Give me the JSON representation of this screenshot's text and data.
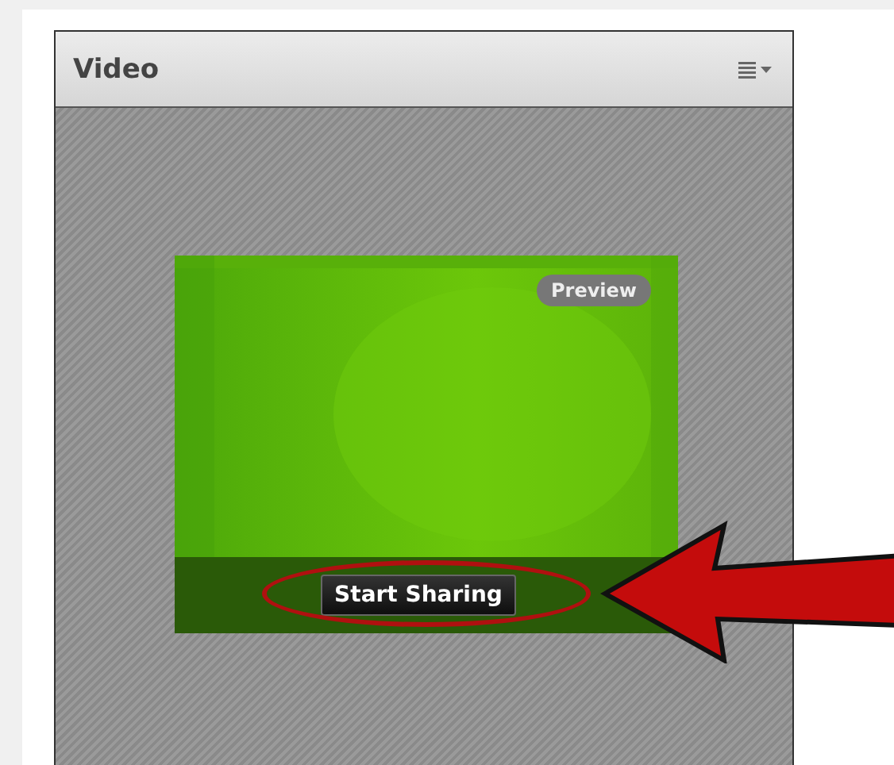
{
  "panel": {
    "title": "Video",
    "preview": {
      "badge": "Preview",
      "button": "Start Sharing"
    }
  }
}
